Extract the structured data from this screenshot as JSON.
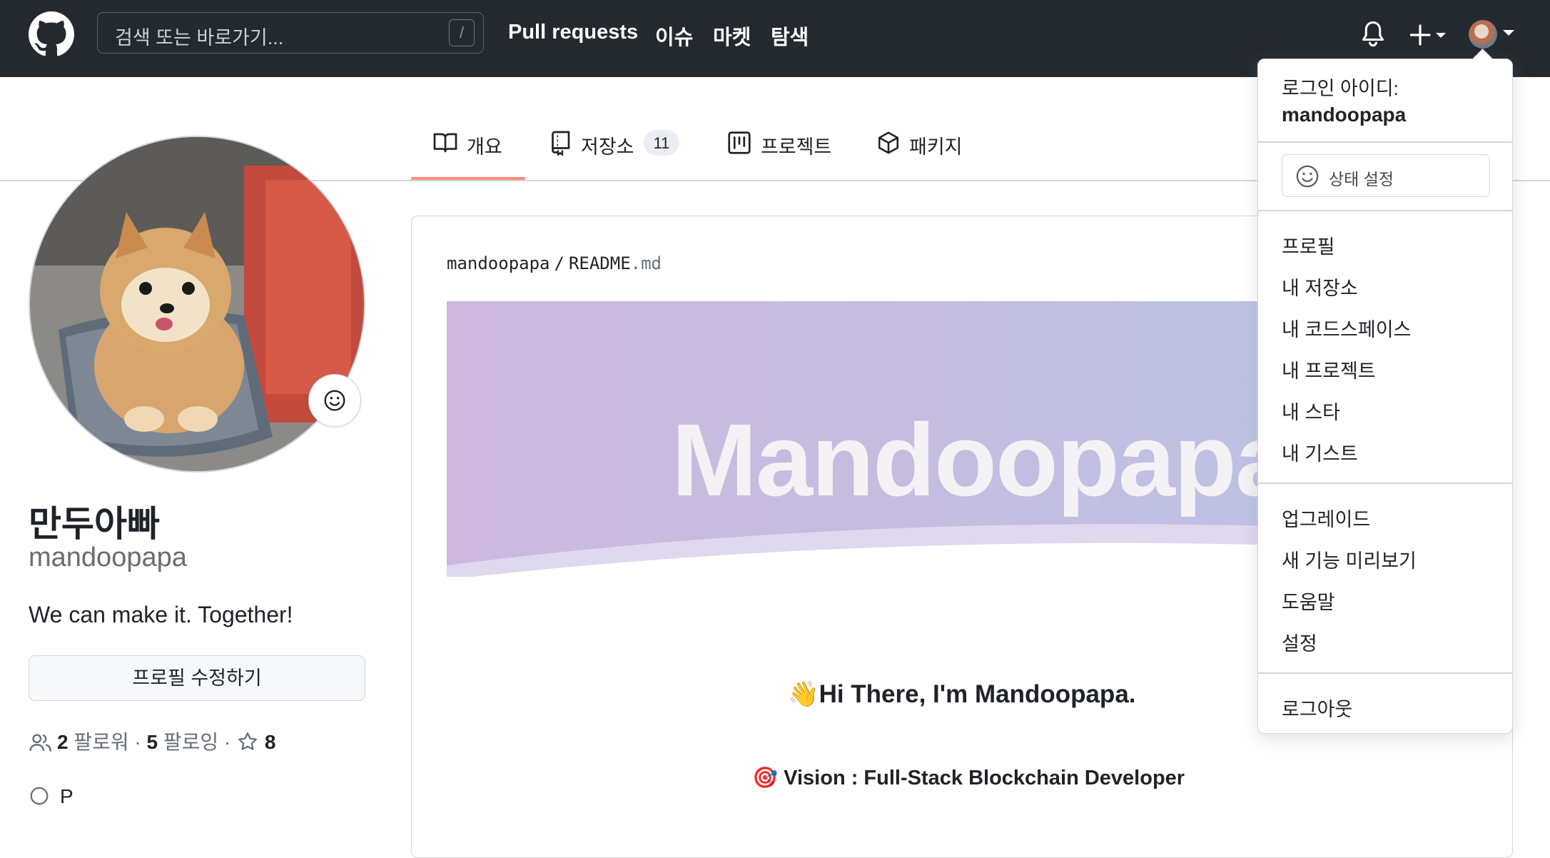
{
  "header": {
    "search_placeholder": "검색 또는 바로가기...",
    "search_shortcut": "/",
    "nav": [
      "Pull requests",
      "이슈",
      "마켓",
      "탐색"
    ]
  },
  "tabs": [
    {
      "label": "개요",
      "icon": "book-icon",
      "active": true
    },
    {
      "label": "저장소",
      "icon": "repo-icon",
      "count": "11"
    },
    {
      "label": "프로젝트",
      "icon": "project-icon"
    },
    {
      "label": "패키지",
      "icon": "package-icon"
    }
  ],
  "profile": {
    "full_name": "만두아빠",
    "username": "mandoopapa",
    "bio": "We can make it. Together!",
    "edit_button": "프로필 수정하기",
    "followers_count": "2",
    "followers_label": "팔로워",
    "following_count": "5",
    "following_label": "팔로잉",
    "stars_count": "8",
    "partial_next_row": "P"
  },
  "readme": {
    "owner": "mandoopapa",
    "separator": "/",
    "file_name": "README",
    "file_ext": ".md",
    "banner_title": "Mandoopapa",
    "greeting": "👋Hi There, I'm Mandoopapa.",
    "vision": "🎯 Vision : Full-Stack Blockchain Developer"
  },
  "menu": {
    "signed_in_label": "로그인 아이디:",
    "signed_in_user": "mandoopapa",
    "status_button": "상태 설정",
    "group1": [
      "프로필",
      "내 저장소",
      "내 코드스페이스",
      "내 프로젝트",
      "내 스타",
      "내 기스트"
    ],
    "group2": [
      "업그레이드",
      "새 기능 미리보기",
      "도움말",
      "설정"
    ],
    "signout": "로그아웃"
  },
  "colors": {
    "header_bg": "#24292f",
    "active_tab_underline": "#fd8c73",
    "banner_start": "#cdb8e0",
    "banner_end": "#b9c4e6"
  }
}
